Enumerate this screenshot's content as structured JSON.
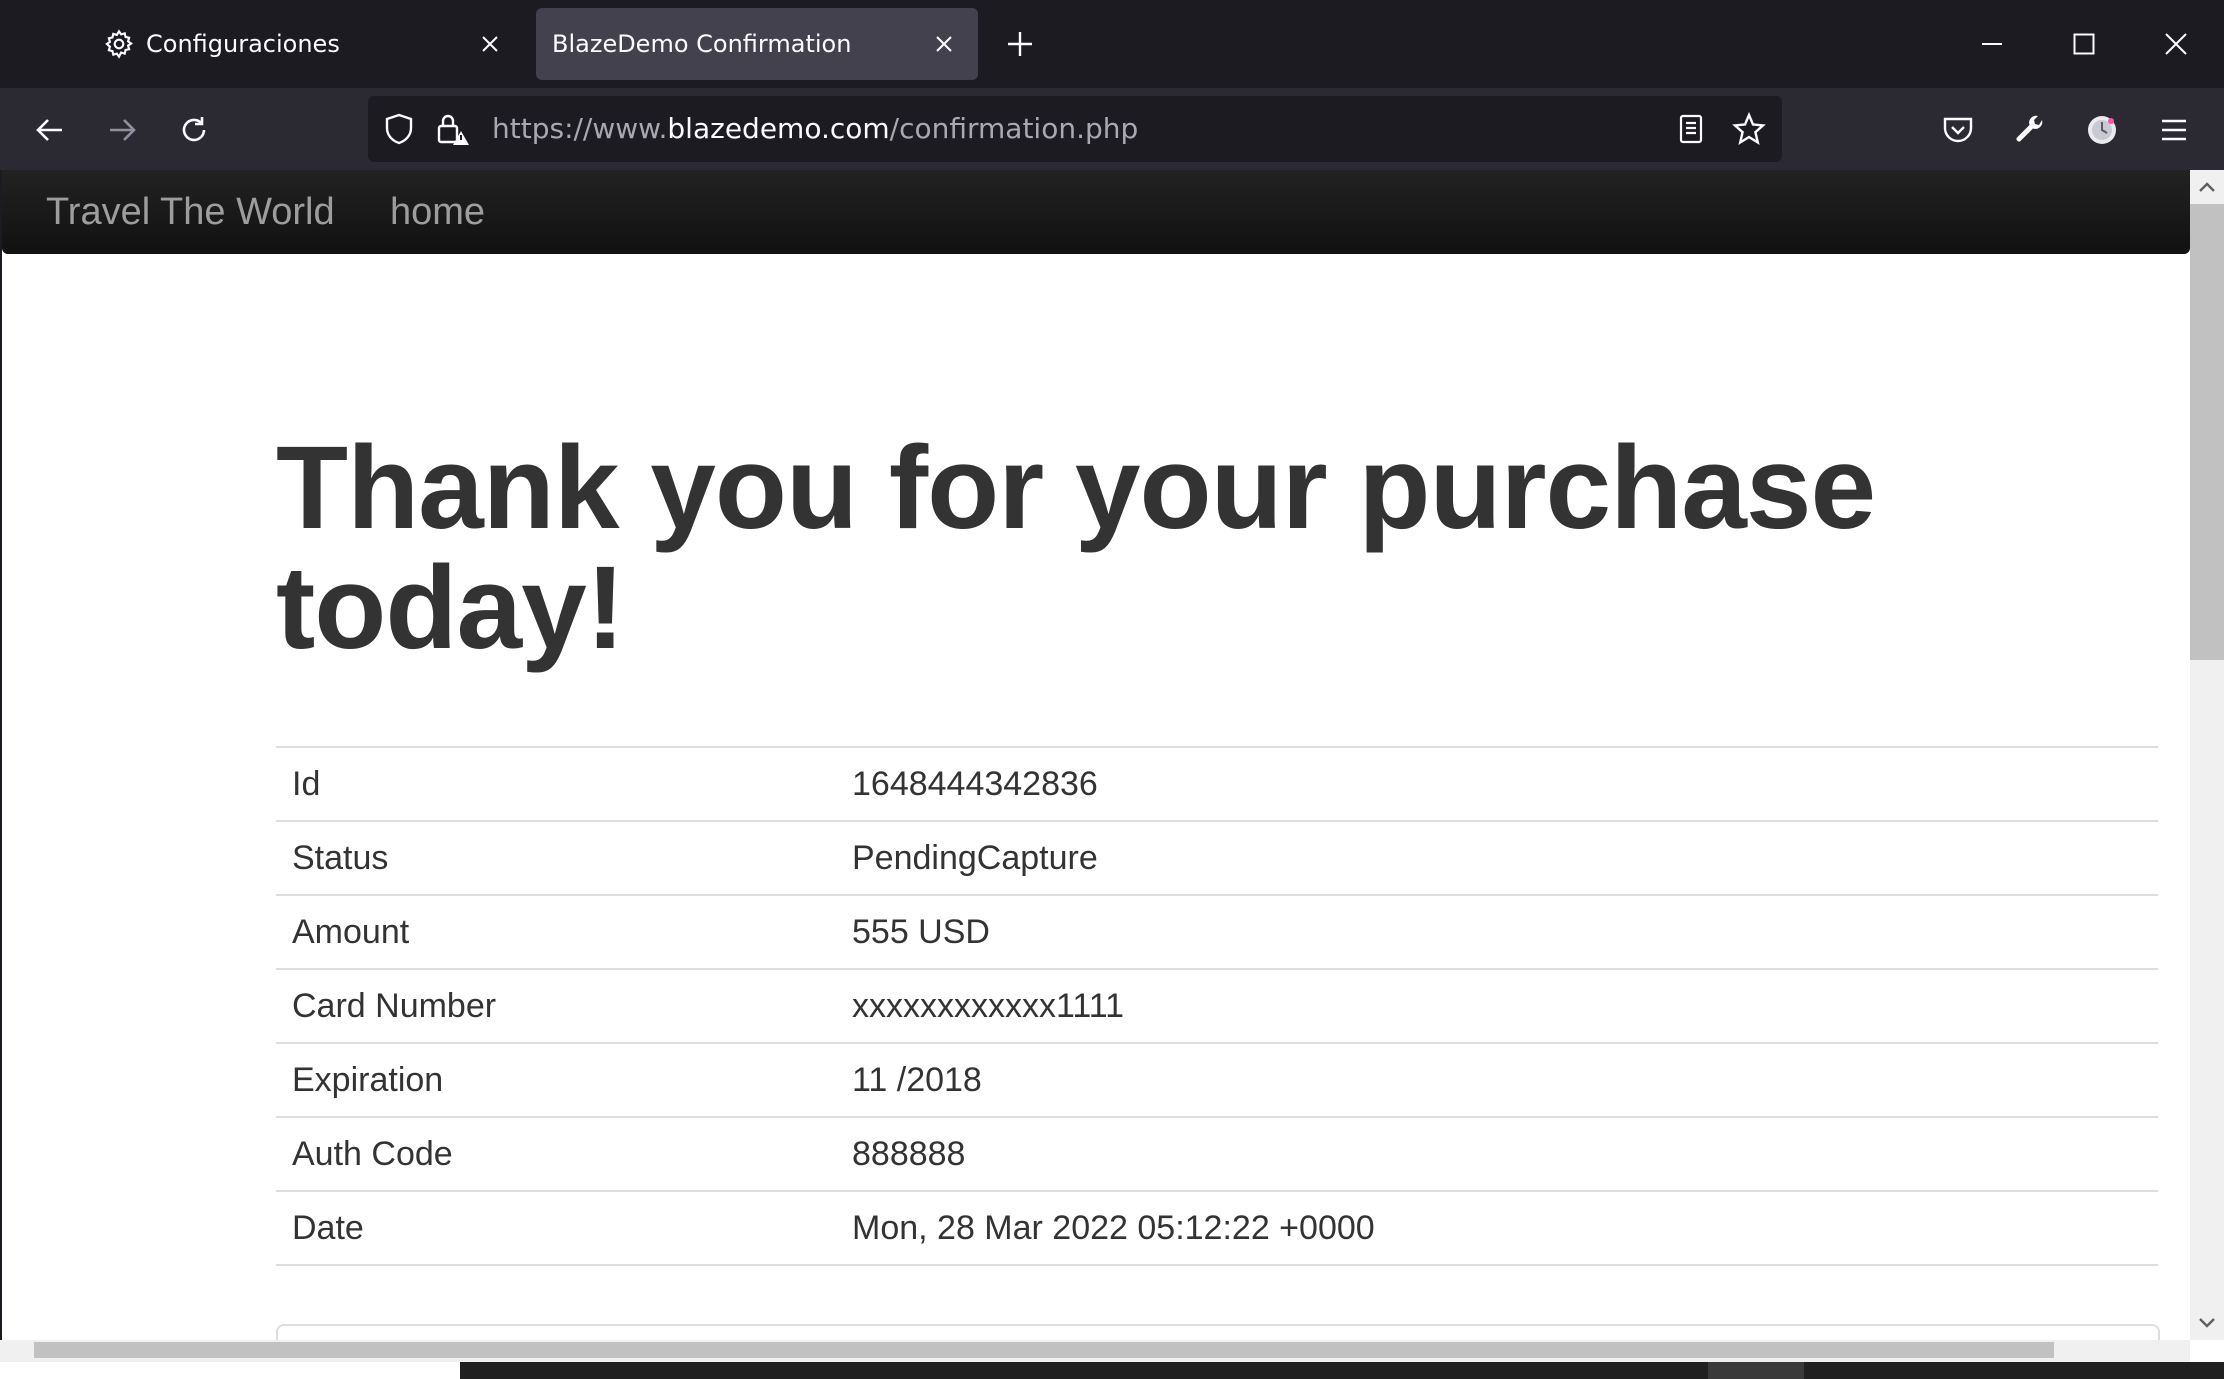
{
  "browser": {
    "tabs": [
      {
        "title": "Configuraciones",
        "icon": "gear-icon",
        "active": false
      },
      {
        "title": "BlazeDemo Confirmation",
        "icon": null,
        "active": true
      }
    ],
    "url": {
      "prefix": "https://www.",
      "host": "blazedemo.com",
      "path": "/confirmation.php"
    },
    "toolbar_icons": [
      "back-arrow-icon",
      "forward-arrow-icon",
      "reload-icon",
      "shield-icon",
      "lock-warning-icon",
      "reader-view-icon",
      "bookmark-star-icon",
      "pocket-icon",
      "wrench-icon",
      "extension-icon",
      "hamburger-menu-icon"
    ]
  },
  "site": {
    "brand": "Travel The World",
    "nav_home": "home",
    "heading": "Thank you for your purchase today!",
    "details": [
      {
        "label": "Id",
        "value": "1648444342836"
      },
      {
        "label": "Status",
        "value": "PendingCapture"
      },
      {
        "label": "Amount",
        "value": "555 USD"
      },
      {
        "label": "Card Number",
        "value": "xxxxxxxxxxxx1111"
      },
      {
        "label": "Expiration",
        "value": "11 /2018"
      },
      {
        "label": "Auth Code",
        "value": "888888"
      },
      {
        "label": "Date",
        "value": "Mon, 28 Mar 2022 05:12:22 +0000"
      }
    ]
  },
  "colors": {
    "chrome_dark": "#1c1b22",
    "chrome_toolbar": "#2b2a33",
    "active_tab": "#42414d",
    "site_nav": "#222222",
    "nav_text": "#9d9d9d",
    "body_text": "#333333",
    "table_border": "#dddddd"
  }
}
